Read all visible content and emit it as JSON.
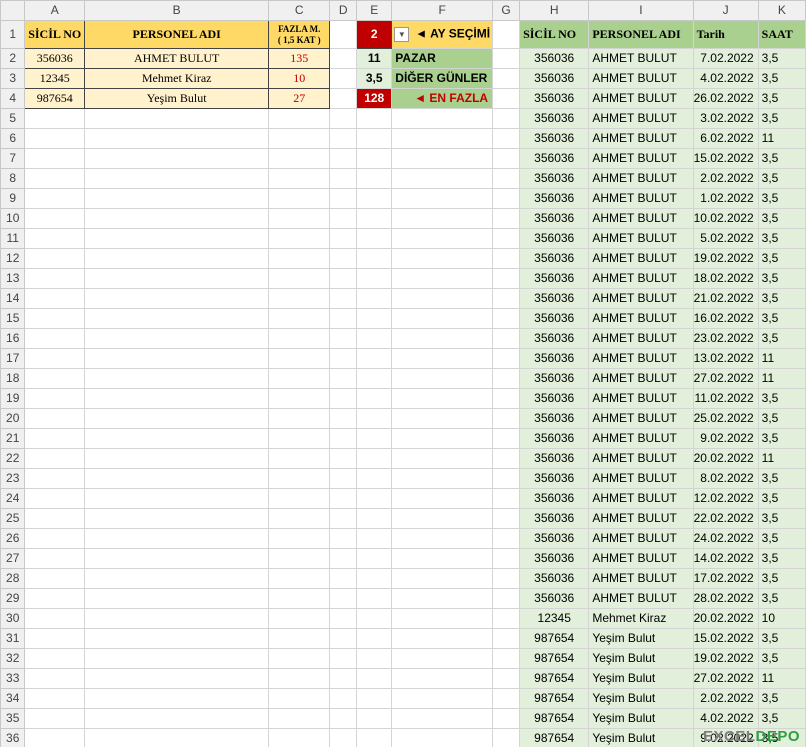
{
  "columns": [
    "A",
    "B",
    "C",
    "D",
    "E",
    "F",
    "G",
    "H",
    "I",
    "J",
    "K"
  ],
  "summary": {
    "headers": {
      "sicil": "SİCİL NO",
      "personel": "PERSONEL ADI",
      "fazla_line1": "FAZLA M.",
      "fazla_line2": "( 1,5 KAT )"
    },
    "rows": [
      {
        "sicil": "356036",
        "name": "AHMET BULUT",
        "fazla": "135"
      },
      {
        "sicil": "12345",
        "name": "Mehmet Kiraz",
        "fazla": "10"
      },
      {
        "sicil": "987654",
        "name": "Yeşim Bulut",
        "fazla": "27"
      }
    ]
  },
  "control": {
    "month_value": "2",
    "ay_secimi_label": "◄ AY SEÇİMİ",
    "pazar_value": "11",
    "pazar_label": "PAZAR",
    "diger_value": "3,5",
    "diger_label": "DİĞER GÜNLER",
    "en_fazla_value": "128",
    "en_fazla_label": "◄ EN FAZLA"
  },
  "records": {
    "headers": {
      "sicil": "SİCİL NO",
      "personel": "PERSONEL ADI",
      "tarih": "Tarih",
      "saat": "SAAT"
    },
    "rows": [
      [
        "356036",
        "AHMET BULUT",
        "7.02.2022",
        "3,5"
      ],
      [
        "356036",
        "AHMET BULUT",
        "4.02.2022",
        "3,5"
      ],
      [
        "356036",
        "AHMET BULUT",
        "26.02.2022",
        "3,5"
      ],
      [
        "356036",
        "AHMET BULUT",
        "3.02.2022",
        "3,5"
      ],
      [
        "356036",
        "AHMET BULUT",
        "6.02.2022",
        "11"
      ],
      [
        "356036",
        "AHMET BULUT",
        "15.02.2022",
        "3,5"
      ],
      [
        "356036",
        "AHMET BULUT",
        "2.02.2022",
        "3,5"
      ],
      [
        "356036",
        "AHMET BULUT",
        "1.02.2022",
        "3,5"
      ],
      [
        "356036",
        "AHMET BULUT",
        "10.02.2022",
        "3,5"
      ],
      [
        "356036",
        "AHMET BULUT",
        "5.02.2022",
        "3,5"
      ],
      [
        "356036",
        "AHMET BULUT",
        "19.02.2022",
        "3,5"
      ],
      [
        "356036",
        "AHMET BULUT",
        "18.02.2022",
        "3,5"
      ],
      [
        "356036",
        "AHMET BULUT",
        "21.02.2022",
        "3,5"
      ],
      [
        "356036",
        "AHMET BULUT",
        "16.02.2022",
        "3,5"
      ],
      [
        "356036",
        "AHMET BULUT",
        "23.02.2022",
        "3,5"
      ],
      [
        "356036",
        "AHMET BULUT",
        "13.02.2022",
        "11"
      ],
      [
        "356036",
        "AHMET BULUT",
        "27.02.2022",
        "11"
      ],
      [
        "356036",
        "AHMET BULUT",
        "11.02.2022",
        "3,5"
      ],
      [
        "356036",
        "AHMET BULUT",
        "25.02.2022",
        "3,5"
      ],
      [
        "356036",
        "AHMET BULUT",
        "9.02.2022",
        "3,5"
      ],
      [
        "356036",
        "AHMET BULUT",
        "20.02.2022",
        "11"
      ],
      [
        "356036",
        "AHMET BULUT",
        "8.02.2022",
        "3,5"
      ],
      [
        "356036",
        "AHMET BULUT",
        "12.02.2022",
        "3,5"
      ],
      [
        "356036",
        "AHMET BULUT",
        "22.02.2022",
        "3,5"
      ],
      [
        "356036",
        "AHMET BULUT",
        "24.02.2022",
        "3,5"
      ],
      [
        "356036",
        "AHMET BULUT",
        "14.02.2022",
        "3,5"
      ],
      [
        "356036",
        "AHMET BULUT",
        "17.02.2022",
        "3,5"
      ],
      [
        "356036",
        "AHMET BULUT",
        "28.02.2022",
        "3,5"
      ],
      [
        "12345",
        "Mehmet Kiraz",
        "20.02.2022",
        "10"
      ],
      [
        "987654",
        "Yeşim Bulut",
        "15.02.2022",
        "3,5"
      ],
      [
        "987654",
        "Yeşim Bulut",
        "19.02.2022",
        "3,5"
      ],
      [
        "987654",
        "Yeşim Bulut",
        "27.02.2022",
        "11"
      ],
      [
        "987654",
        "Yeşim Bulut",
        "2.02.2022",
        "3,5"
      ],
      [
        "987654",
        "Yeşim Bulut",
        "4.02.2022",
        "3,5"
      ],
      [
        "987654",
        "Yeşim Bulut",
        "9.02.2022",
        "3,5"
      ]
    ]
  },
  "watermark": {
    "part1": "EXCEL",
    "part2": "DEPO"
  },
  "colors": {
    "header_yellow": "#ffd966",
    "header_green": "#a9d08e",
    "accent_red": "#c00000",
    "light_green": "#e2efda",
    "light_yellow": "#fff2cc"
  }
}
